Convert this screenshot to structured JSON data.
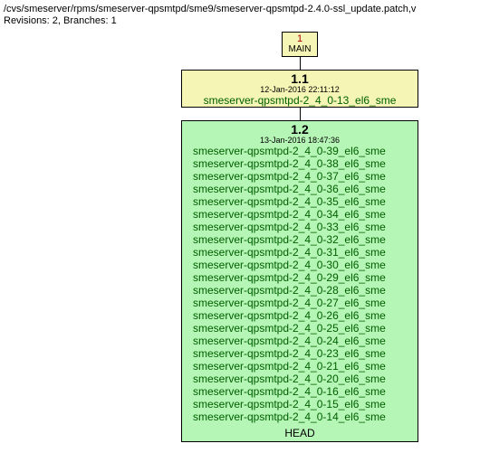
{
  "header": {
    "path": "/cvs/smeserver/rpms/smeserver-qpsmtpd/sme9/smeserver-qpsmtpd-2.4.0-ssl_update.patch,v",
    "revline": "Revisions: 2, Branches: 1"
  },
  "main_node": {
    "number": "1",
    "label": "MAIN"
  },
  "rev11": {
    "version": "1.1",
    "date": "12-Jan-2016 22:11:12",
    "tag": "smeserver-qpsmtpd-2_4_0-13_el6_sme"
  },
  "rev12": {
    "version": "1.2",
    "date": "13-Jan-2016 18:47:36",
    "tags": [
      "smeserver-qpsmtpd-2_4_0-39_el6_sme",
      "smeserver-qpsmtpd-2_4_0-38_el6_sme",
      "smeserver-qpsmtpd-2_4_0-37_el6_sme",
      "smeserver-qpsmtpd-2_4_0-36_el6_sme",
      "smeserver-qpsmtpd-2_4_0-35_el6_sme",
      "smeserver-qpsmtpd-2_4_0-34_el6_sme",
      "smeserver-qpsmtpd-2_4_0-33_el6_sme",
      "smeserver-qpsmtpd-2_4_0-32_el6_sme",
      "smeserver-qpsmtpd-2_4_0-31_el6_sme",
      "smeserver-qpsmtpd-2_4_0-30_el6_sme",
      "smeserver-qpsmtpd-2_4_0-29_el6_sme",
      "smeserver-qpsmtpd-2_4_0-28_el6_sme",
      "smeserver-qpsmtpd-2_4_0-27_el6_sme",
      "smeserver-qpsmtpd-2_4_0-26_el6_sme",
      "smeserver-qpsmtpd-2_4_0-25_el6_sme",
      "smeserver-qpsmtpd-2_4_0-24_el6_sme",
      "smeserver-qpsmtpd-2_4_0-23_el6_sme",
      "smeserver-qpsmtpd-2_4_0-21_el6_sme",
      "smeserver-qpsmtpd-2_4_0-20_el6_sme",
      "smeserver-qpsmtpd-2_4_0-16_el6_sme",
      "smeserver-qpsmtpd-2_4_0-15_el6_sme",
      "smeserver-qpsmtpd-2_4_0-14_el6_sme"
    ],
    "head": "HEAD"
  },
  "chart_data": {
    "type": "tree",
    "title": "CVS revision graph",
    "nodes": [
      {
        "id": "MAIN",
        "label": "1 MAIN"
      },
      {
        "id": "1.1",
        "date": "12-Jan-2016 22:11:12",
        "tags": [
          "smeserver-qpsmtpd-2_4_0-13_el6_sme"
        ]
      },
      {
        "id": "1.2",
        "date": "13-Jan-2016 18:47:36",
        "head": true,
        "tags": [
          "smeserver-qpsmtpd-2_4_0-39_el6_sme",
          "smeserver-qpsmtpd-2_4_0-38_el6_sme",
          "smeserver-qpsmtpd-2_4_0-37_el6_sme",
          "smeserver-qpsmtpd-2_4_0-36_el6_sme",
          "smeserver-qpsmtpd-2_4_0-35_el6_sme",
          "smeserver-qpsmtpd-2_4_0-34_el6_sme",
          "smeserver-qpsmtpd-2_4_0-33_el6_sme",
          "smeserver-qpsmtpd-2_4_0-32_el6_sme",
          "smeserver-qpsmtpd-2_4_0-31_el6_sme",
          "smeserver-qpsmtpd-2_4_0-30_el6_sme",
          "smeserver-qpsmtpd-2_4_0-29_el6_sme",
          "smeserver-qpsmtpd-2_4_0-28_el6_sme",
          "smeserver-qpsmtpd-2_4_0-27_el6_sme",
          "smeserver-qpsmtpd-2_4_0-26_el6_sme",
          "smeserver-qpsmtpd-2_4_0-25_el6_sme",
          "smeserver-qpsmtpd-2_4_0-24_el6_sme",
          "smeserver-qpsmtpd-2_4_0-23_el6_sme",
          "smeserver-qpsmtpd-2_4_0-21_el6_sme",
          "smeserver-qpsmtpd-2_4_0-20_el6_sme",
          "smeserver-qpsmtpd-2_4_0-16_el6_sme",
          "smeserver-qpsmtpd-2_4_0-15_el6_sme",
          "smeserver-qpsmtpd-2_4_0-14_el6_sme"
        ]
      }
    ],
    "edges": [
      {
        "from": "MAIN",
        "to": "1.1"
      },
      {
        "from": "1.1",
        "to": "1.2"
      }
    ]
  }
}
